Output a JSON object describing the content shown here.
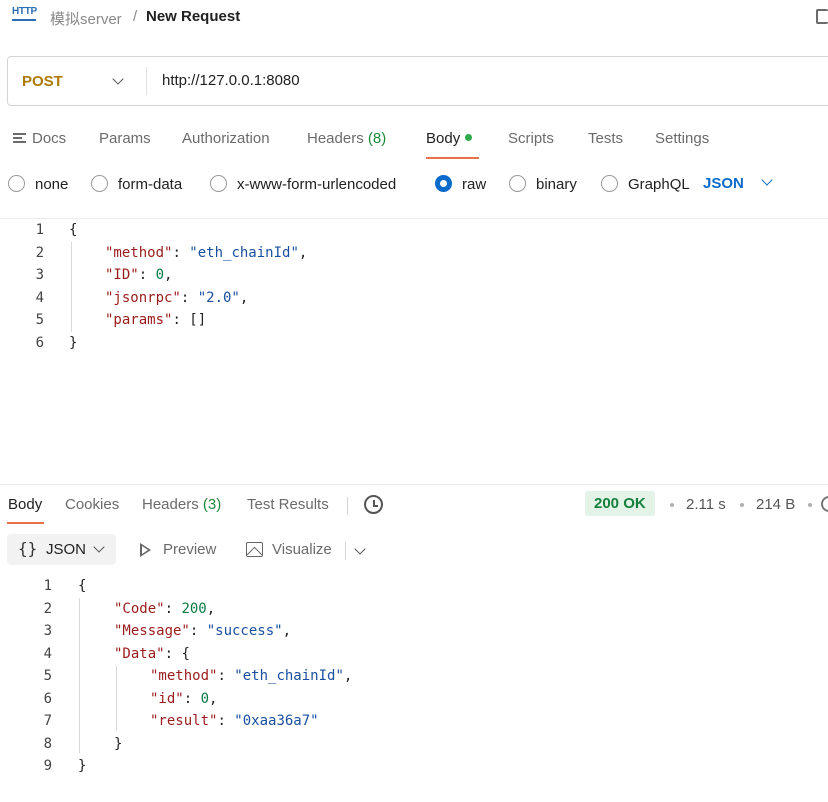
{
  "breadcrumb": {
    "icon_text": "HTTP",
    "parent": "模拟server",
    "separator": "/",
    "current": "New Request"
  },
  "request": {
    "method": "POST",
    "url": "http://127.0.0.1:8080"
  },
  "request_tabs": {
    "docs": "Docs",
    "params": "Params",
    "authorization": "Authorization",
    "headers": "Headers",
    "headers_count": "(8)",
    "body": "Body",
    "scripts": "Scripts",
    "tests": "Tests",
    "settings": "Settings"
  },
  "body_types": {
    "none": "none",
    "form_data": "form-data",
    "urlencoded": "x-www-form-urlencoded",
    "raw": "raw",
    "binary": "binary",
    "graphql": "GraphQL",
    "selected": "raw",
    "language": "JSON"
  },
  "request_body": {
    "line_numbers": [
      "1",
      "2",
      "3",
      "4",
      "5",
      "6"
    ],
    "open": "{",
    "close": "}",
    "punct": {
      "colon": ": ",
      "comma": ","
    },
    "fields": [
      {
        "key": "\"method\"",
        "value": "\"eth_chainId\""
      },
      {
        "key": "\"ID\"",
        "value": "0"
      },
      {
        "key": "\"jsonrpc\"",
        "value": "\"2.0\""
      },
      {
        "key": "\"params\"",
        "value": "[]"
      }
    ]
  },
  "response_tabs": {
    "body": "Body",
    "cookies": "Cookies",
    "headers": "Headers",
    "headers_count": "(3)",
    "test_results": "Test Results"
  },
  "response_meta": {
    "status": "200 OK",
    "time": "2.11 s",
    "size": "214 B"
  },
  "response_toolbar": {
    "format_braces": "{}",
    "format": "JSON",
    "preview": "Preview",
    "visualize": "Visualize"
  },
  "response_body": {
    "line_numbers": [
      "1",
      "2",
      "3",
      "4",
      "5",
      "6",
      "7",
      "8",
      "9"
    ],
    "open": "{",
    "close": "}",
    "punct": {
      "colon": ": ",
      "comma": ","
    },
    "code_key": "\"Code\"",
    "code_value": "200",
    "message_key": "\"Message\"",
    "message_value": "\"success\"",
    "data_key": "\"Data\"",
    "data_open": "{",
    "data_close": "}",
    "data_fields": [
      {
        "key": "\"method\"",
        "value": "\"eth_chainId\""
      },
      {
        "key": "\"id\"",
        "value": "0"
      },
      {
        "key": "\"result\"",
        "value": "\"0xaa36a7\""
      }
    ]
  },
  "colors": {
    "accent_tab": "#e8734a",
    "method_post": "#ad7a03",
    "status_ok": "#15803d",
    "primary_blue": "#0b6bcb",
    "json_key": "#9b1c1c",
    "json_string": "#1a4fa0",
    "json_number": "#0a7a43"
  },
  "icons": [
    "http-icon",
    "doc-icon",
    "chevron-down-icon",
    "docs-icon",
    "history-icon",
    "globe-icon",
    "play-icon",
    "image-icon"
  ]
}
